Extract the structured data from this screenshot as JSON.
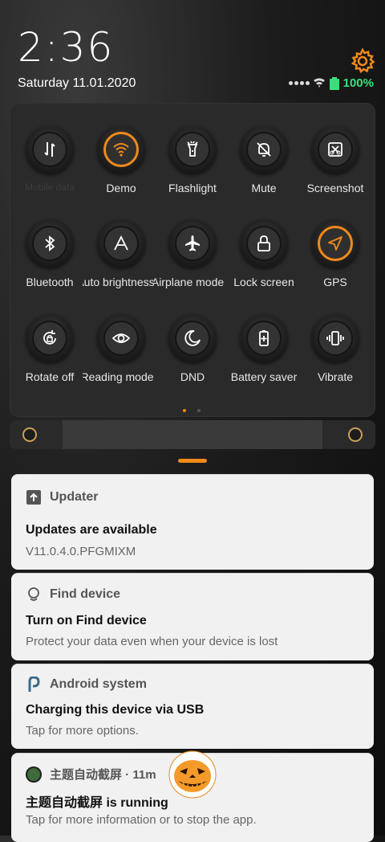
{
  "status": {
    "time": "2:36",
    "date": "Saturday 11.01.2020",
    "battery": "100%",
    "accent": "#f08a1a",
    "battery_color": "#39e07a"
  },
  "quick_settings": {
    "tiles": [
      {
        "label": "Mobile data",
        "icon": "mobile-data-icon",
        "active": false
      },
      {
        "label": "Demo",
        "icon": "wifi-icon",
        "active": true
      },
      {
        "label": "Flashlight",
        "icon": "flashlight-icon",
        "active": false
      },
      {
        "label": "Mute",
        "icon": "bell-off-icon",
        "active": false
      },
      {
        "label": "Screenshot",
        "icon": "screenshot-icon",
        "active": false
      },
      {
        "label": "Bluetooth",
        "icon": "bluetooth-icon",
        "active": false
      },
      {
        "label": "Auto brightness",
        "icon": "auto-brightness-icon",
        "active": false
      },
      {
        "label": "Airplane mode",
        "icon": "airplane-icon",
        "active": false
      },
      {
        "label": "Lock screen",
        "icon": "lock-icon",
        "active": false
      },
      {
        "label": "GPS",
        "icon": "location-arrow-icon",
        "active": true
      },
      {
        "label": "Rotate off",
        "icon": "rotation-lock-icon",
        "active": false
      },
      {
        "label": "Reading mode",
        "icon": "eye-icon",
        "active": false
      },
      {
        "label": "DND",
        "icon": "moon-icon",
        "active": false
      },
      {
        "label": "Battery saver",
        "icon": "battery-saver-icon",
        "active": false
      },
      {
        "label": "Vibrate",
        "icon": "vibrate-icon",
        "active": false
      }
    ],
    "page_index": 0,
    "page_count": 2
  },
  "brightness": {
    "level": 0.15
  },
  "notifications": [
    {
      "app": "Updater",
      "icon": "upload-icon",
      "title": "Updates are available",
      "body": "V11.0.4.0.PFGMIXM"
    },
    {
      "app": "Find device",
      "icon": "find-device-icon",
      "title": "Turn on Find device",
      "body": "Protect your data even when your device is lost"
    },
    {
      "app": "Android system",
      "icon": "android-system-icon",
      "title": "Charging this device via USB",
      "body": "Tap for more options."
    },
    {
      "app": "主题自动截屏 · 11m",
      "icon": "app-icon",
      "title": "主题自动截屏 is running",
      "body": "Tap for more information or to stop the app."
    }
  ]
}
